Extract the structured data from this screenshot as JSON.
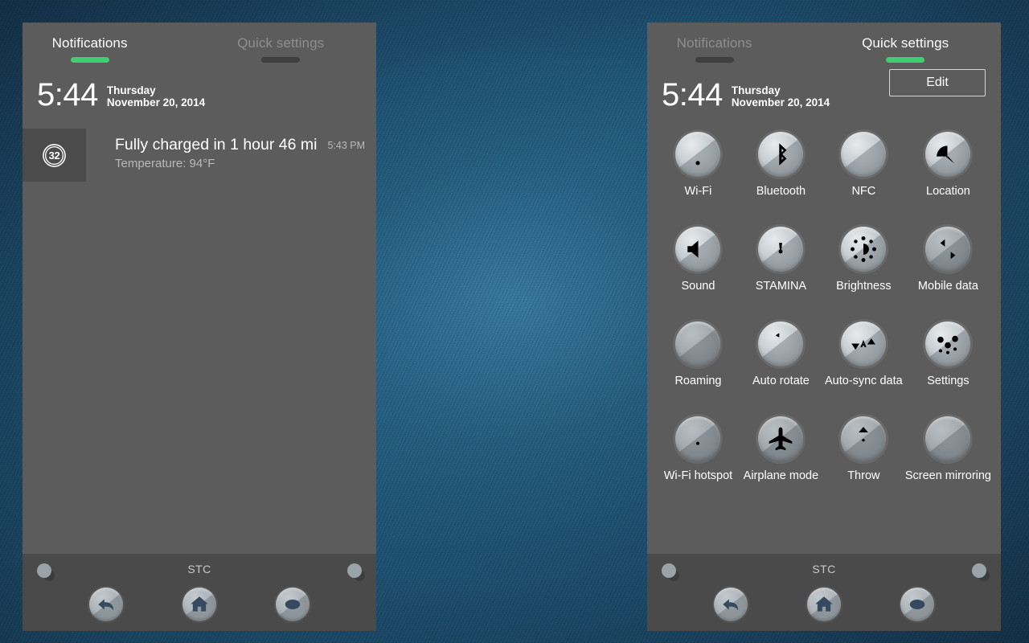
{
  "wallpaper": {
    "name": "denim-texture",
    "base_color": "#1d5679"
  },
  "panels": {
    "notifications": {
      "tabs": {
        "left_label": "Notifications",
        "right_label": "Quick settings",
        "active": "Notifications"
      },
      "clock": {
        "time": "5:44",
        "weekday": "Thursday",
        "date": "November 20, 2014"
      },
      "notification": {
        "badge_value": "32",
        "title": "Fully charged in 1 hour 46 mi",
        "subtitle": "Temperature: 94°F",
        "time": "5:43 PM"
      },
      "navbar": {
        "carrier": "STC"
      }
    },
    "quicksettings": {
      "tabs": {
        "left_label": "Notifications",
        "right_label": "Quick settings",
        "active": "Quick settings"
      },
      "clock": {
        "time": "5:44",
        "weekday": "Thursday",
        "date": "November 20, 2014"
      },
      "edit_label": "Edit",
      "tiles": [
        {
          "label": "Wi-Fi",
          "icon": "wifi-icon",
          "state": "on"
        },
        {
          "label": "Bluetooth",
          "icon": "bluetooth-icon",
          "state": "on"
        },
        {
          "label": "NFC",
          "icon": "nfc-icon",
          "state": "on"
        },
        {
          "label": "Location",
          "icon": "location-icon",
          "state": "on"
        },
        {
          "label": "Sound",
          "icon": "sound-icon",
          "state": "on"
        },
        {
          "label": "STAMINA",
          "icon": "stamina-icon",
          "state": "on"
        },
        {
          "label": "Brightness",
          "icon": "brightness-icon",
          "state": "on"
        },
        {
          "label": "Mobile data",
          "icon": "mobile-data-icon",
          "state": "off"
        },
        {
          "label": "Roaming",
          "icon": "roaming-icon",
          "state": "off"
        },
        {
          "label": "Auto rotate",
          "icon": "auto-rotate-icon",
          "state": "on"
        },
        {
          "label": "Auto-sync data",
          "icon": "auto-sync-icon",
          "state": "on"
        },
        {
          "label": "Settings",
          "icon": "settings-sliders-icon",
          "state": "on"
        },
        {
          "label": "Wi-Fi hotspot",
          "icon": "wifi-hotspot-icon",
          "state": "off"
        },
        {
          "label": "Airplane mode",
          "icon": "airplane-icon",
          "state": "off"
        },
        {
          "label": "Throw",
          "icon": "throw-icon",
          "state": "off"
        },
        {
          "label": "Screen mirroring",
          "icon": "screen-mirroring-icon",
          "state": "off"
        }
      ],
      "navbar": {
        "carrier": "STC"
      }
    }
  },
  "colors": {
    "panel_bg": "#5c5c5c",
    "accent_green": "#3ecf73",
    "navbar_bg": "#4a4a4a",
    "glyph_on": "#2d4460",
    "glyph_off": "#6f7478"
  }
}
